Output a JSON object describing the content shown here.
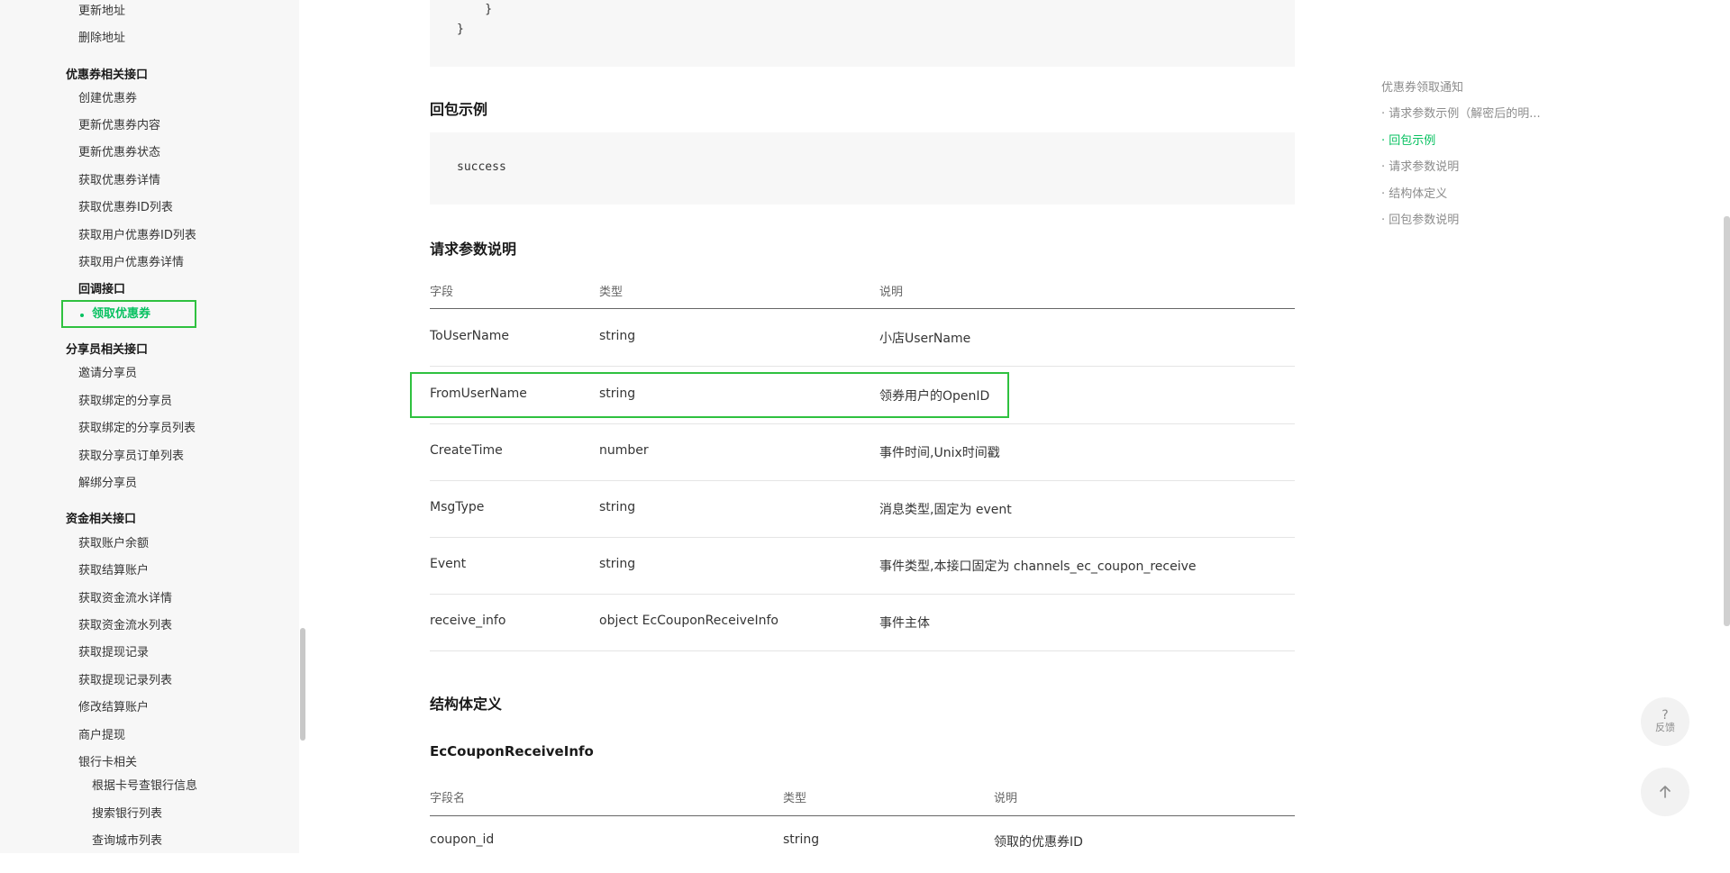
{
  "sidebar": {
    "items_top": [
      "更新地址",
      "删除地址"
    ],
    "coupon_group": "优惠券相关接口",
    "coupon_items": [
      "创建优惠券",
      "更新优惠券内容",
      "更新优惠券状态",
      "获取优惠券详情",
      "获取优惠券ID列表",
      "获取用户优惠券ID列表",
      "获取用户优惠券详情"
    ],
    "callback_head": "回调接口",
    "callback_active": "领取优惠券",
    "sharer_group": "分享员相关接口",
    "sharer_items": [
      "邀请分享员",
      "获取绑定的分享员",
      "获取绑定的分享员列表",
      "获取分享员订单列表",
      "解绑分享员"
    ],
    "funds_group": "资金相关接口",
    "funds_items": [
      "获取账户余额",
      "获取结算账户",
      "获取资金流水详情",
      "获取资金流水列表",
      "获取提现记录",
      "获取提现记录列表",
      "修改结算账户",
      "商户提现",
      "银行卡相关"
    ],
    "bank_items": [
      "根据卡号查银行信息",
      "搜索银行列表",
      "查询城市列表"
    ]
  },
  "main": {
    "code_top": [
      "    }",
      "}"
    ],
    "response_title": "回包示例",
    "response_code": "success",
    "params_title": "请求参数说明",
    "params_headers": [
      "字段",
      "类型",
      "说明"
    ],
    "params_rows": [
      [
        "ToUserName",
        "string",
        "小店UserName"
      ],
      [
        "FromUserName",
        "string",
        "领券用户的OpenID"
      ],
      [
        "CreateTime",
        "number",
        "事件时间,Unix时间戳"
      ],
      [
        "MsgType",
        "string",
        "消息类型,固定为 event"
      ],
      [
        "Event",
        "string",
        "事件类型,本接口固定为 channels_ec_coupon_receive"
      ],
      [
        "receive_info",
        "object EcCouponReceiveInfo",
        "事件主体"
      ]
    ],
    "struct_title": "结构体定义",
    "struct_name": "EcCouponReceiveInfo",
    "struct_headers": [
      "字段名",
      "类型",
      "说明"
    ],
    "struct_rows": [
      [
        "coupon_id",
        "string",
        "领取的优惠券ID"
      ]
    ]
  },
  "toc": {
    "title": "优惠券领取通知",
    "items": [
      "· 请求参数示例（解密后的明...",
      "· 回包示例",
      "· 请求参数说明",
      "· 结构体定义",
      "· 回包参数说明"
    ],
    "active_index": 1
  },
  "floating": {
    "feedback_mark": "?",
    "feedback_label": "反馈"
  },
  "colors": {
    "accent": "#07c160",
    "highlight": "#2fc13f"
  }
}
